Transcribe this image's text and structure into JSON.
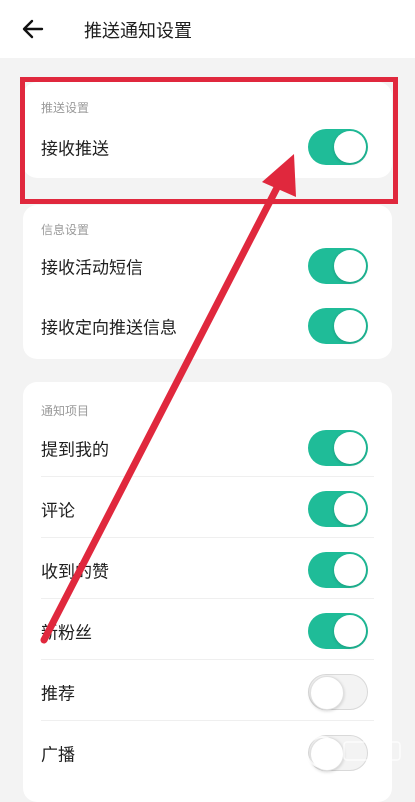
{
  "header": {
    "title": "推送通知设置",
    "back_icon": "arrow-left-icon"
  },
  "colors": {
    "accent": "#1fbc98",
    "annotation": "#e0283d"
  },
  "sections": [
    {
      "label": "推送设置",
      "items": [
        {
          "label": "接收推送",
          "enabled": true
        }
      ]
    },
    {
      "label": "信息设置",
      "items": [
        {
          "label": "接收活动短信",
          "enabled": true
        },
        {
          "label": "接收定向推送信息",
          "enabled": true
        }
      ]
    },
    {
      "label": "通知项目",
      "items": [
        {
          "label": "提到我的",
          "enabled": true
        },
        {
          "label": "评论",
          "enabled": true
        },
        {
          "label": "收到的赞",
          "enabled": true
        },
        {
          "label": "新粉丝",
          "enabled": true
        },
        {
          "label": "推荐",
          "enabled": false
        },
        {
          "label": "广播",
          "enabled": false
        }
      ]
    }
  ]
}
